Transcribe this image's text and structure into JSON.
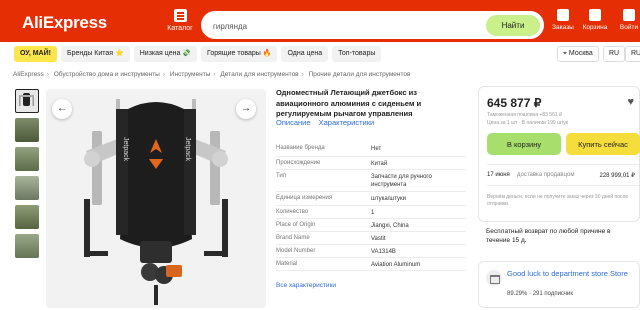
{
  "header": {
    "logo": "AliExpress",
    "catalog_label": "Каталог",
    "search_value": "гирлянда",
    "search_button": "Найти",
    "orders_label": "Заказы",
    "cart_label": "Корзина",
    "login_label": "Войти",
    "brand_color": "#e62e04"
  },
  "promo": {
    "chips": [
      "ОУ, МАЙ!",
      "Бренды Китая ⭐",
      "Низкая цена 💸",
      "Горящие товары 🔥",
      "Одна цена",
      "Топ-товары"
    ],
    "city": "Москва",
    "language": "RU",
    "currency": "RUB"
  },
  "breadcrumbs": [
    "AliExpress",
    "Обустройство дома и инструменты",
    "Инструменты",
    "Детали для инструментов",
    "Прочие детали для инструментов"
  ],
  "gallery": {
    "prev_icon": "chevron-left-icon",
    "next_icon": "chevron-right-icon",
    "strap_text": "Jetpack"
  },
  "product": {
    "title": "Одноместный Летающий джетбокс из авиационного алюминия с сиденьем и регулируемым рычагом управления",
    "tabs": [
      "Описание",
      "Характеристики"
    ],
    "specs": [
      {
        "key": "Название бренда",
        "value": "Нет"
      },
      {
        "key": "Происхождение",
        "value": "Китай"
      },
      {
        "key": "Тип",
        "value": "Запчасти для ручного инструмента"
      },
      {
        "key": "Единица измерения",
        "value": "штука/штуки"
      },
      {
        "key": "Количество",
        "value": "1"
      },
      {
        "key": "Place of Origin",
        "value": "Jiangxi, China"
      },
      {
        "key": "Brand Name",
        "value": "Vastit"
      },
      {
        "key": "Model Number",
        "value": "VA1314B"
      },
      {
        "key": "Material",
        "value": "Aviation Aluminum"
      }
    ],
    "all_specs_link": "Все характеристики"
  },
  "buybox": {
    "price": "645 877 ₽",
    "customs_note": "Таможенная пошлина +83 561 ₽",
    "unit_note": "Цена за 1 шт · В наличии 199 штук",
    "add_to_cart": "В корзину",
    "buy_now": "Купить сейчас",
    "delivery_date": "17 июня",
    "delivery_label": "доставка продавцом",
    "delivery_price": "228 999,01 ₽",
    "refund_policy_note": "Вернём деньги, если не получите заказ через 30 дней после отправки.",
    "free_return": "Бесплатный возврат по любой причине в течение 15 д."
  },
  "store": {
    "name": "Good luck to department store Store",
    "rating": "89.29%",
    "followers": "291 подписчик"
  }
}
